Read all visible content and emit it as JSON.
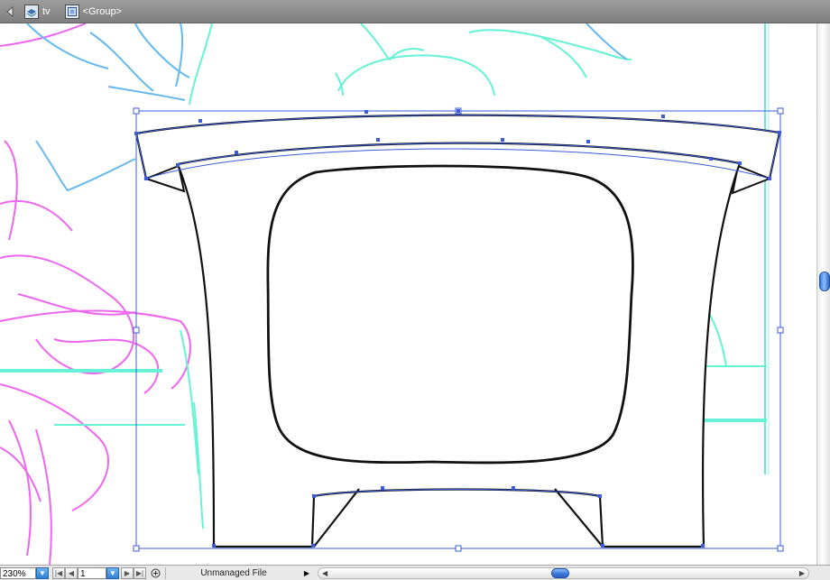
{
  "breadcrumb": {
    "layer_name": "tv",
    "group_name": "<Group>",
    "icons": [
      "back-arrow-icon",
      "layer-icon",
      "group-icon"
    ]
  },
  "statusbar": {
    "zoom": "230%",
    "page": "1",
    "status_text": "Unmanaged File",
    "icons": [
      "zoom-dropdown-icon",
      "first-page-icon",
      "prev-page-icon",
      "page-dropdown-icon",
      "next-page-icon",
      "last-page-icon",
      "status-icon",
      "status-menu-arrow-icon",
      "scroll-left-icon",
      "scroll-right-icon"
    ]
  },
  "colors": {
    "selection": "#3b5bdb",
    "sketch_magenta": "#ee66ee",
    "sketch_cyan": "#66f2d6",
    "sketch_blue": "#66b8f0",
    "artwork_stroke": "#111111"
  }
}
